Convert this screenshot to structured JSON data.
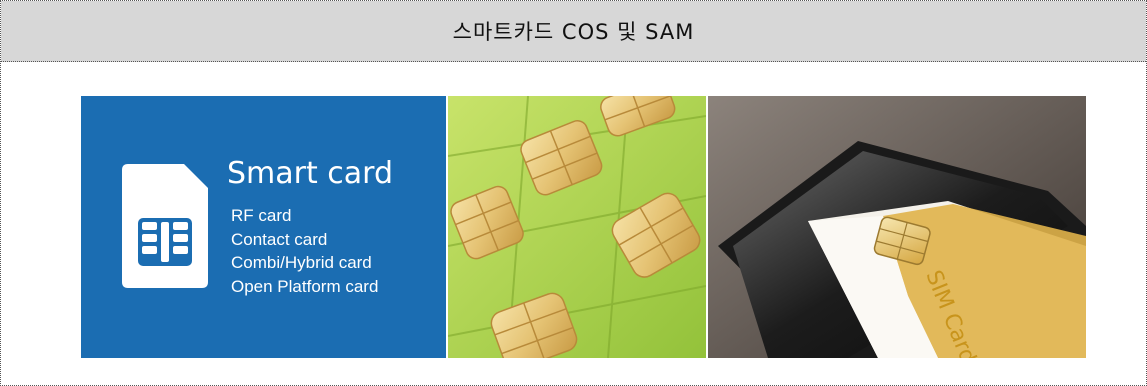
{
  "header": {
    "title": "스마트카드 COS 및 SAM"
  },
  "panel_smart_card": {
    "title": "Smart card",
    "items": [
      "RF card",
      "Contact card",
      "Combi/Hybrid card",
      "Open Platform card"
    ]
  },
  "panel_sim_photo": {
    "card_label": "SIM Card"
  },
  "colors": {
    "header_bg": "#d7d7d7",
    "smart_card_blue": "#1b6db2",
    "chip_gold": "#e5c374",
    "card_green": "#b4d94a"
  }
}
